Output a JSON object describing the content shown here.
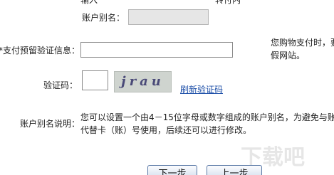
{
  "top_fragment_left": "输入",
  "top_fragment_right": "转付内",
  "alias": {
    "label": "账户别名：",
    "value": ""
  },
  "preset_verification": {
    "label": "支付预留验证信息：",
    "required_mark": "*",
    "value": ""
  },
  "side_note": "您购物支付时，要\n假网站。",
  "captcha": {
    "label": "验证码：",
    "value": "",
    "image_text": "jrau",
    "refresh_link": "刷新验证码"
  },
  "alias_help": {
    "label": "账户别名说明：",
    "text": "您可以设置一个由4－15位字母或数字组成的账户别名，为避免与账\n代替卡（账）号使用，后续还可以进行修改。"
  },
  "buttons": {
    "next": "下一步",
    "prev": "上一步"
  },
  "watermark": "下载吧"
}
